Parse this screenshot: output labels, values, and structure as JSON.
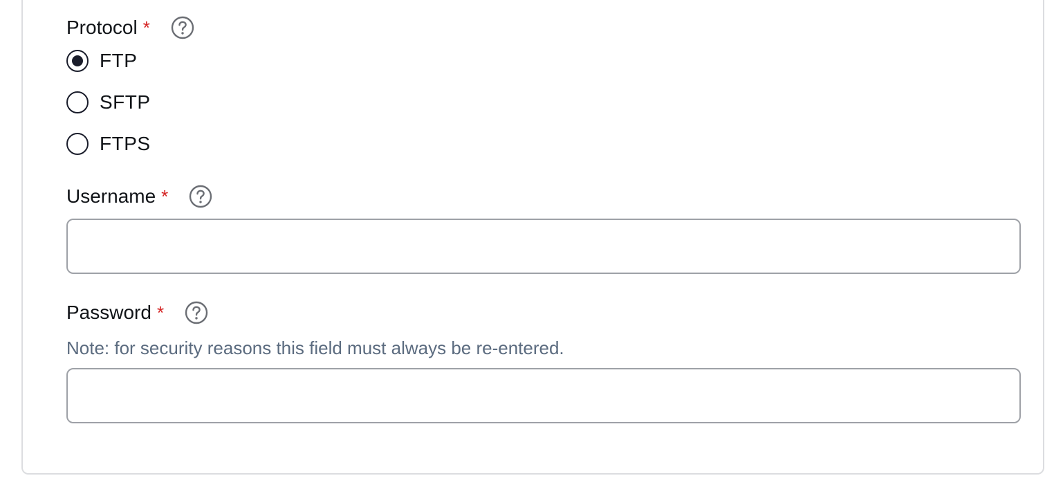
{
  "protocol": {
    "label": "Protocol",
    "required_mark": "*",
    "help_icon": "question-circle-icon",
    "options": [
      {
        "label": "FTP",
        "selected": true
      },
      {
        "label": "SFTP",
        "selected": false
      },
      {
        "label": "FTPS",
        "selected": false
      }
    ]
  },
  "username": {
    "label": "Username",
    "required_mark": "*",
    "help_icon": "question-circle-icon",
    "value": "",
    "placeholder": ""
  },
  "password": {
    "label": "Password",
    "required_mark": "*",
    "help_icon": "question-circle-icon",
    "note": "Note: for security reasons this field must always be re-entered.",
    "value": "",
    "placeholder": ""
  },
  "colors": {
    "required": "#d42222",
    "note_text": "#5b6b7f",
    "radio": "#1a1d2b",
    "input_border": "#9ea1a7",
    "card_border": "#dcdde0"
  }
}
